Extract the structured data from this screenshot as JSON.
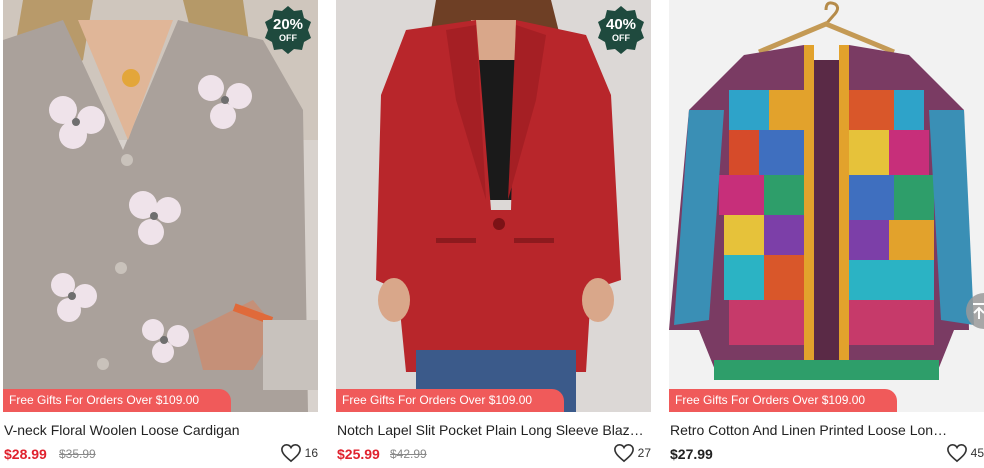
{
  "products": [
    {
      "title": "V-neck Floral Woolen Loose Cardigan",
      "price": "$28.99",
      "old_price": "$35.99",
      "badge_pct": "20%",
      "badge_off": "OFF",
      "promo": "Free Gifts For Orders Over $109.00",
      "likes": "16"
    },
    {
      "title": "Notch Lapel Slit Pocket Plain Long Sleeve Blazers",
      "price": "$25.99",
      "old_price": "$42.99",
      "badge_pct": "40%",
      "badge_off": "OFF",
      "promo": "Free Gifts For Orders Over $109.00",
      "likes": "27"
    },
    {
      "title": "Retro Cotton And Linen Printed Loose Long-sleeve Coat",
      "price": "$27.99",
      "promo": "Free Gifts For Orders Over $109.00",
      "likes": "45"
    }
  ],
  "colors": {
    "price_sale": "#e0222e",
    "promo_bg": "#f05a5a",
    "badge_bg": "#1f4a3e"
  },
  "icons": [
    "heart-outline-icon",
    "back-to-top-icon"
  ]
}
